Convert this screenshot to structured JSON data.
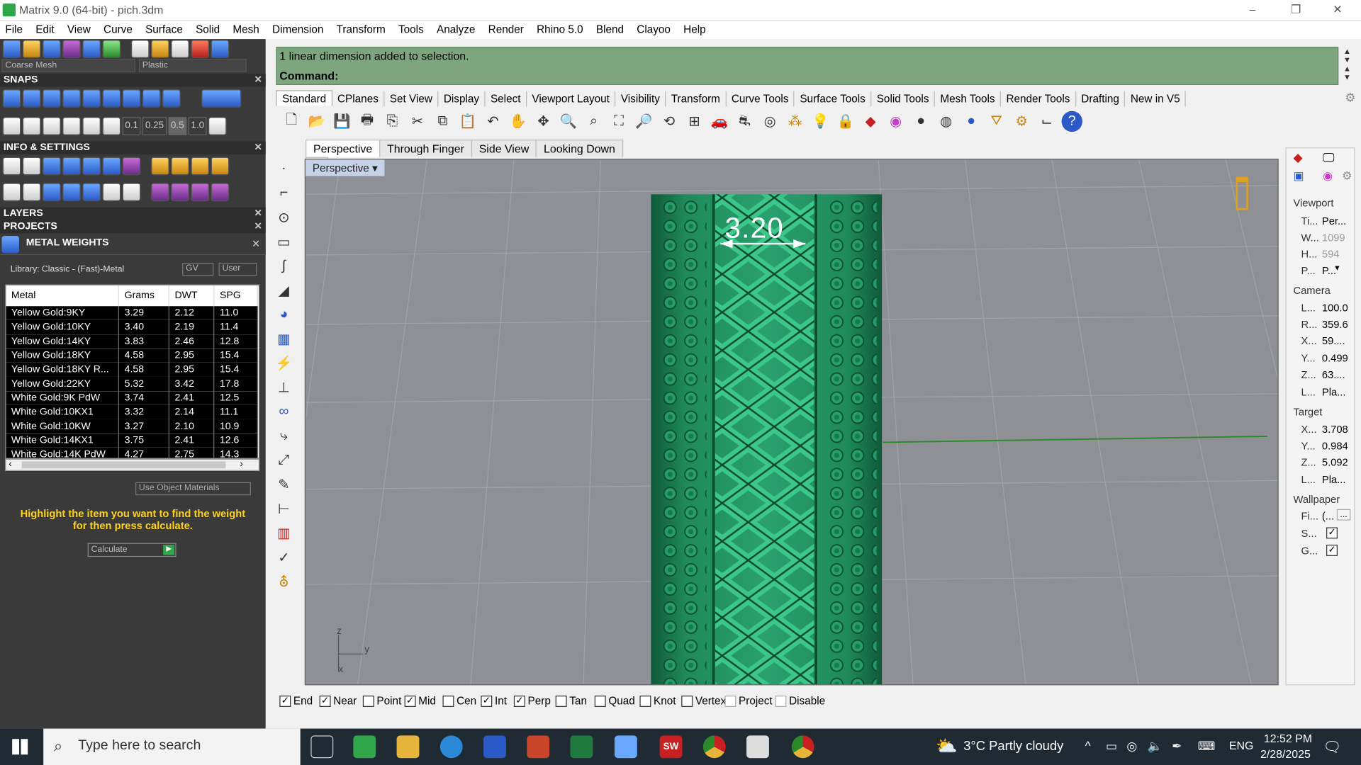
{
  "window": {
    "title": "Matrix 9.0 (64-bit) - pich.3dm",
    "minimize": "–",
    "restore": "❐",
    "close": "✕"
  },
  "menu": [
    "File",
    "Edit",
    "View",
    "Curve",
    "Surface",
    "Solid",
    "Mesh",
    "Dimension",
    "Transform",
    "Tools",
    "Analyze",
    "Render",
    "Rhino 5.0",
    "Blend",
    "Clayoo",
    "Help"
  ],
  "left_panel": {
    "mesh_combo": "Coarse Mesh",
    "material_combo": "Plastic",
    "snaps_title": "SNAPS",
    "snap_values": [
      "0.1",
      "0.25",
      "0.5",
      "1.0"
    ],
    "info_title": "INFO & SETTINGS",
    "layers_title": "LAYERS",
    "projects_title": "PROJECTS",
    "metal_weights_title": "METAL WEIGHTS",
    "library": "Library: Classic - (Fast)-Metal",
    "gv_label": "GV",
    "user_label": "User",
    "table": {
      "headers": [
        "Metal",
        "Grams",
        "DWT",
        "SPG"
      ],
      "rows": [
        [
          "Yellow Gold:9KY",
          "3.29",
          "2.12",
          "11.0"
        ],
        [
          "Yellow Gold:10KY",
          "3.40",
          "2.19",
          "11.4"
        ],
        [
          "Yellow Gold:14KY",
          "3.83",
          "2.46",
          "12.8"
        ],
        [
          "Yellow Gold:18KY",
          "4.58",
          "2.95",
          "15.4"
        ],
        [
          "Yellow Gold:18KY R...",
          "4.58",
          "2.95",
          "15.4"
        ],
        [
          "Yellow Gold:22KY",
          "5.32",
          "3.42",
          "17.8"
        ],
        [
          "White Gold:9K PdW",
          "3.74",
          "2.41",
          "12.5"
        ],
        [
          "White Gold:10KX1",
          "3.32",
          "2.14",
          "11.1"
        ],
        [
          "White Gold:10KW",
          "3.27",
          "2.10",
          "10.9"
        ],
        [
          "White Gold:14KX1",
          "3.75",
          "2.41",
          "12.6"
        ],
        [
          "White Gold:14K PdW",
          "4.27",
          "2.75",
          "14.3"
        ]
      ]
    },
    "use_object_materials": "Use Object Materials",
    "hint": "Highlight the item you want to find the weight for then press calculate.",
    "calculate": "Calculate"
  },
  "command": {
    "history": "1 linear dimension added to selection.",
    "prompt": "Command:"
  },
  "toolbar_tabs": [
    "Standard",
    "CPlanes",
    "Set View",
    "Display",
    "Select",
    "Viewport Layout",
    "Visibility",
    "Transform",
    "Curve Tools",
    "Surface Tools",
    "Solid Tools",
    "Mesh Tools",
    "Render Tools",
    "Drafting",
    "New in V5"
  ],
  "viewport": {
    "tabs": [
      "Perspective",
      "Through Finger",
      "Side View",
      "Looking Down"
    ],
    "add_tab": "+",
    "label": "Perspective",
    "dimension_text": "3.20",
    "axis": {
      "z": "z",
      "y": "y",
      "x": "x"
    },
    "model_color": "#1f8a5c"
  },
  "right_panel": {
    "viewport_title": "Viewport",
    "viewport_rows": [
      [
        "Ti...",
        "Per..."
      ],
      [
        "W...",
        "1099"
      ],
      [
        "H...",
        "594"
      ],
      [
        "P...",
        "P..."
      ]
    ],
    "camera_title": "Camera",
    "camera_rows": [
      [
        "L...",
        "100.0"
      ],
      [
        "R...",
        "359.6"
      ],
      [
        "X...",
        "59...."
      ],
      [
        "Y...",
        "0.499"
      ],
      [
        "Z...",
        "63...."
      ],
      [
        "L...",
        "Pla..."
      ]
    ],
    "target_title": "Target",
    "target_rows": [
      [
        "X...",
        "3.708"
      ],
      [
        "Y...",
        "0.984"
      ],
      [
        "Z...",
        "5.092"
      ],
      [
        "L...",
        "Pla..."
      ]
    ],
    "wallpaper_title": "Wallpaper",
    "wallpaper_rows": [
      [
        "Fi...",
        "(..."
      ],
      [
        "S...",
        ""
      ],
      [
        "G...",
        ""
      ]
    ],
    "browse": "..."
  },
  "osnap": [
    {
      "label": "End",
      "checked": true
    },
    {
      "label": "Near",
      "checked": true
    },
    {
      "label": "Point",
      "checked": false
    },
    {
      "label": "Mid",
      "checked": true
    },
    {
      "label": "Cen",
      "checked": false
    },
    {
      "label": "Int",
      "checked": true
    },
    {
      "label": "Perp",
      "checked": true
    },
    {
      "label": "Tan",
      "checked": false
    },
    {
      "label": "Quad",
      "checked": false
    },
    {
      "label": "Knot",
      "checked": false
    },
    {
      "label": "Vertex",
      "checked": false
    },
    {
      "label": "Project",
      "checked": false
    },
    {
      "label": "Disable",
      "checked": false
    }
  ],
  "taskbar": {
    "search_placeholder": "Type here to search",
    "weather": "3°C  Partly cloudy",
    "lang": "ENG",
    "time": "12:52 PM",
    "date": "2/28/2025",
    "sw_label": "SW"
  }
}
